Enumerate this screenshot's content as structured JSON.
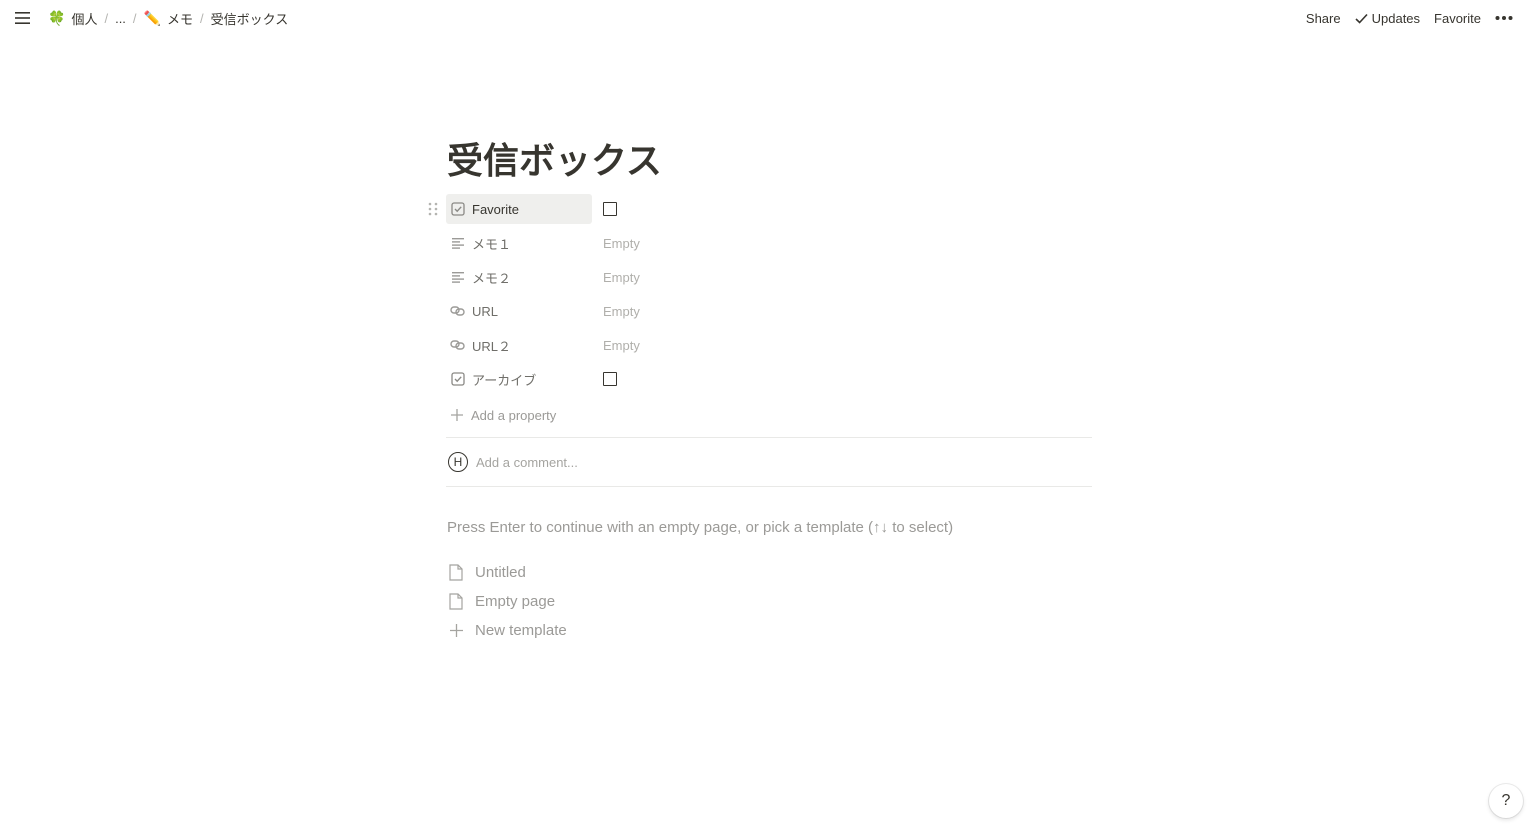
{
  "breadcrumb": {
    "items": [
      {
        "emoji": "🍀",
        "label": "個人"
      },
      {
        "emoji": "",
        "label": "..."
      },
      {
        "emoji": "✏️",
        "label": "メモ"
      },
      {
        "emoji": "",
        "label": "受信ボックス"
      }
    ],
    "separator": "/"
  },
  "actions": {
    "share": "Share",
    "updates": "Updates",
    "favorite": "Favorite"
  },
  "page": {
    "title": "受信ボックス"
  },
  "properties": [
    {
      "name": "Favorite",
      "icon": "checkbox-icon",
      "type": "checkbox",
      "value": ""
    },
    {
      "name": "メモ１",
      "icon": "text-icon",
      "type": "text",
      "value": "Empty"
    },
    {
      "name": "メモ２",
      "icon": "text-icon",
      "type": "text",
      "value": "Empty"
    },
    {
      "name": "URL",
      "icon": "link-icon",
      "type": "url",
      "value": "Empty"
    },
    {
      "name": "URL２",
      "icon": "link-icon",
      "type": "url",
      "value": "Empty"
    },
    {
      "name": "アーカイブ",
      "icon": "checkbox-icon",
      "type": "checkbox",
      "value": ""
    }
  ],
  "add_property": "Add a property",
  "comment": {
    "avatar_initial": "H",
    "placeholder": "Add a comment..."
  },
  "hint": "Press Enter to continue with an empty page, or pick a template (↑↓ to select)",
  "templates": [
    {
      "label": "Untitled",
      "icon": "page-icon"
    },
    {
      "label": "Empty page",
      "icon": "page-icon"
    },
    {
      "label": "New template",
      "icon": "plus-icon"
    }
  ],
  "help": {
    "label": "?"
  },
  "colors": {
    "text": "#37352f",
    "muted": "#9b9a97",
    "hover_bg": "#efefed",
    "divider": "#e9e9e7"
  }
}
